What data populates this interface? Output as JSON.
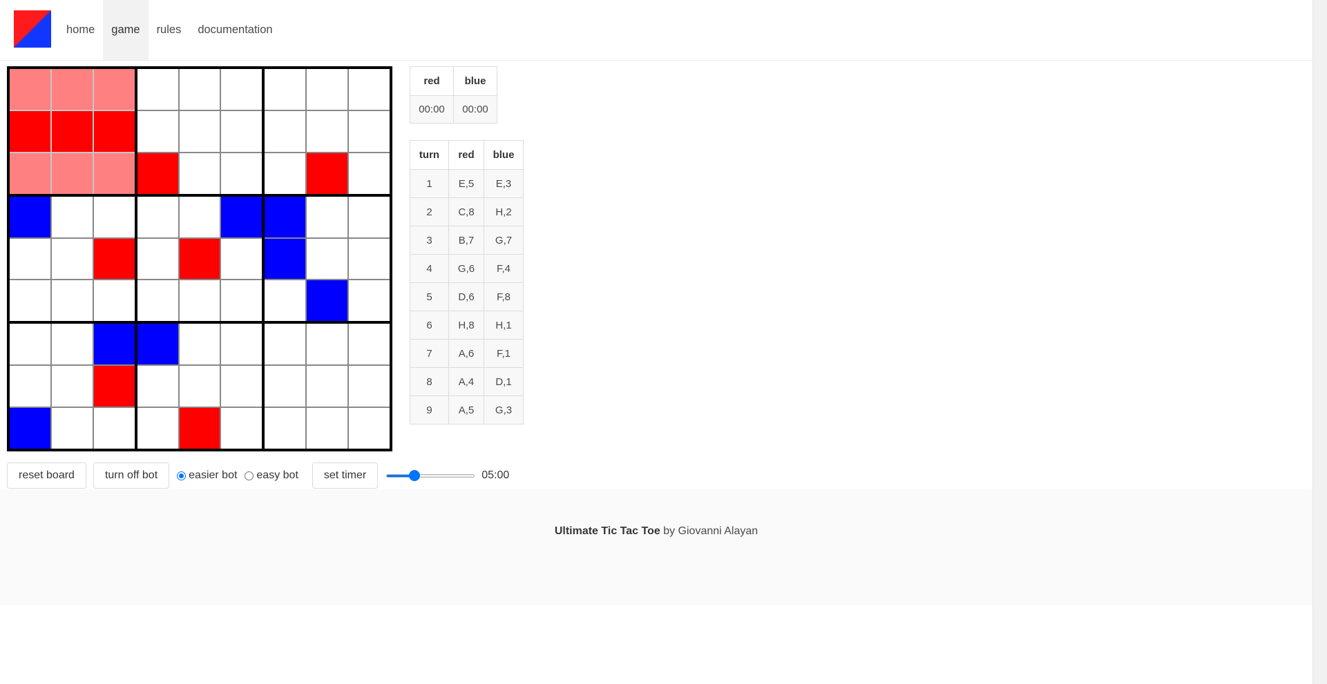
{
  "nav": {
    "items": [
      {
        "label": "home",
        "active": false
      },
      {
        "label": "game",
        "active": true
      },
      {
        "label": "rules",
        "active": false
      },
      {
        "label": "documentation",
        "active": false
      }
    ]
  },
  "board": {
    "boards": [
      [
        "pink",
        "pink",
        "pink",
        "red",
        "red",
        "red",
        "pink",
        "pink",
        "pink"
      ],
      [
        "empty",
        "empty",
        "empty",
        "empty",
        "empty",
        "empty",
        "red",
        "empty",
        "empty"
      ],
      [
        "empty",
        "empty",
        "empty",
        "empty",
        "empty",
        "empty",
        "empty",
        "red",
        "empty"
      ],
      [
        "blue",
        "empty",
        "empty",
        "empty",
        "empty",
        "red",
        "empty",
        "empty",
        "empty"
      ],
      [
        "empty",
        "empty",
        "blue",
        "empty",
        "red",
        "empty",
        "empty",
        "empty",
        "empty"
      ],
      [
        "blue",
        "empty",
        "empty",
        "blue",
        "empty",
        "empty",
        "empty",
        "blue",
        "empty"
      ],
      [
        "empty",
        "empty",
        "blue",
        "empty",
        "empty",
        "red",
        "blue",
        "empty",
        "empty"
      ],
      [
        "blue",
        "empty",
        "empty",
        "empty",
        "empty",
        "empty",
        "empty",
        "red",
        "empty"
      ],
      [
        "empty",
        "empty",
        "empty",
        "empty",
        "empty",
        "empty",
        "empty",
        "empty",
        "empty"
      ]
    ],
    "colors": {
      "red": "#ff0000",
      "blue": "#0000ff",
      "pink": "#ff8080"
    }
  },
  "timers": {
    "headers": [
      "red",
      "blue"
    ],
    "values": [
      "00:00",
      "00:00"
    ]
  },
  "moves": {
    "headers": [
      "turn",
      "red",
      "blue"
    ],
    "rows": [
      [
        "1",
        "E,5",
        "E,3"
      ],
      [
        "2",
        "C,8",
        "H,2"
      ],
      [
        "3",
        "B,7",
        "G,7"
      ],
      [
        "4",
        "G,6",
        "F,4"
      ],
      [
        "5",
        "D,6",
        "F,8"
      ],
      [
        "6",
        "H,8",
        "H,1"
      ],
      [
        "7",
        "A,6",
        "F,1"
      ],
      [
        "8",
        "A,4",
        "D,1"
      ],
      [
        "9",
        "A,5",
        "G,3"
      ]
    ]
  },
  "controls": {
    "reset_label": "reset board",
    "bot_label": "turn off bot",
    "radio_options": [
      {
        "label": "easier bot",
        "checked": true
      },
      {
        "label": "easy bot",
        "checked": false
      }
    ],
    "set_timer_label": "set timer",
    "slider_fraction": 0.29,
    "timer_value": "05:00"
  },
  "footer": {
    "title": "Ultimate Tic Tac Toe",
    "by_text": " by Giovanni Alayan"
  }
}
